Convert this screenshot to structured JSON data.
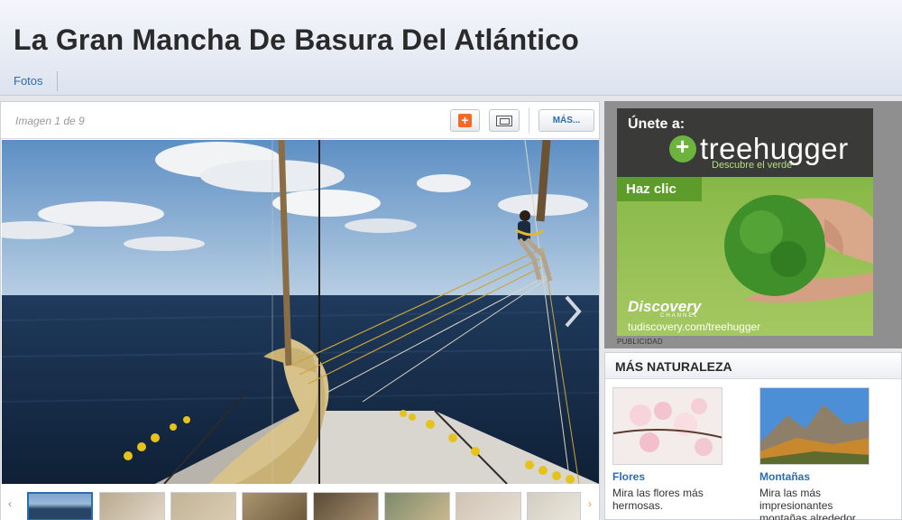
{
  "header": {
    "title": "La Gran Mancha De Basura Del Atlántico",
    "nav": [
      "Fotos"
    ]
  },
  "gallery": {
    "counter": "Imagen 1 de 9",
    "more_label": "MÁS...",
    "add_label": "+"
  },
  "ad": {
    "join": "Únete a:",
    "logo": "treehugger",
    "tagline": "Descubre el verde",
    "cta": "Haz clic",
    "brand": "Discovery",
    "brand_sub": "CHANNEL",
    "url": "tudiscovery.com/treehugger",
    "label": "PUBLICIDAD"
  },
  "more": {
    "title": "MÁS NATURALEZA",
    "cards": [
      {
        "title": "Flores",
        "desc": "Mira las flores más hermosas."
      },
      {
        "title": "Montañas",
        "desc": "Mira las más impresionantes montañas alrededor del mundo."
      }
    ]
  }
}
